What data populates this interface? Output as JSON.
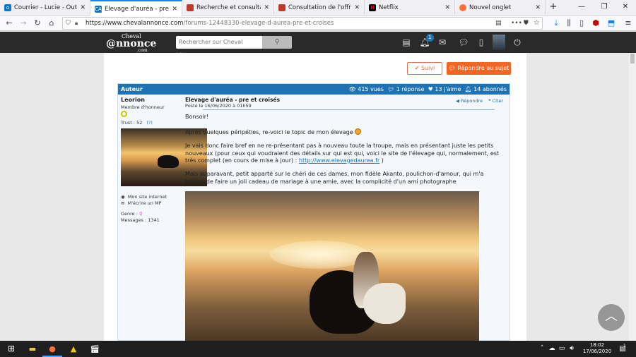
{
  "browser": {
    "tabs": [
      {
        "title": "Courrier - Lucie - Outlook",
        "icon": "outlook-icon",
        "color": "#0078d4",
        "active": false
      },
      {
        "title": "Elevage d'auréa - pre et cro",
        "icon": "chevalannonce-icon",
        "color": "#1e73b4",
        "active": true
      },
      {
        "title": "Recherche et consultation d",
        "icon": "pole-emploi-icon",
        "color": "#c0392b",
        "active": false
      },
      {
        "title": "Consultation de l'offre OM",
        "icon": "pole-emploi-icon",
        "color": "#c0392b",
        "active": false
      },
      {
        "title": "Netflix",
        "icon": "netflix-icon",
        "color": "#e50914",
        "active": false
      },
      {
        "title": "Nouvel onglet",
        "icon": "firefox-icon",
        "color": "#ff7139",
        "active": false
      }
    ],
    "url_host": "https://www.chevalannonce.com",
    "url_path": "/forums-12448330-elevage-d-aurea-pre-et-croises",
    "new_tab": "+"
  },
  "site": {
    "logo_top": "Cheval",
    "logo_main": "@nnonce",
    "logo_sub": ".com",
    "search_placeholder": "Rechercher sur Cheval Annonce",
    "notification_count": "1"
  },
  "actions": {
    "follow_label": "Suivi",
    "reply_label": "Répondre au sujet"
  },
  "thread_bar": {
    "author_col": "Auteur",
    "views": "415 vues",
    "replies": "1 réponse",
    "likes": "13 j'aime",
    "subscribers": "14 abonnés"
  },
  "author": {
    "name": "Leorion",
    "rank": "Membre d'honneur",
    "trust": "Trust : 52",
    "trust_help": "(?)",
    "website": "Mon site internet",
    "write_mp": "M'écrire un MP",
    "gender_label": "Genre :",
    "messages": "Messages : 1341"
  },
  "post": {
    "title": "Elevage d'auréa - pre et croisés",
    "date": "Posté le 16/06/2020 à 01h59",
    "reply": "Répondre",
    "quote": "Citer",
    "greeting": "Bonsoir!",
    "p1": "Après quelques péripéties, re-voici le topic de mon élevage",
    "p2": "Je vais donc faire bref en ne re-présentant pas à nouveau toute la troupe, mais en présentant juste les petits nouveaux (pour ceux qui voudraient des détails sur qui est qui, voici le site de l'élevage qui, normalement, est très complet (en cours de mise à jour) :",
    "link": "http://www.elevagedaurea.fr",
    "p2_end": ")",
    "p3": "Mais auparavant, petit apparté sur le chéri de ces dames, mon fidèle Akanto, poulichon-d'amour, qui m'a permis de faire un joli cadeau de mariage à une amie, avec la complicité d'un ami photographe"
  },
  "taskbar": {
    "time": "18:02",
    "date": "17/06/2020",
    "notif_count": "1"
  }
}
